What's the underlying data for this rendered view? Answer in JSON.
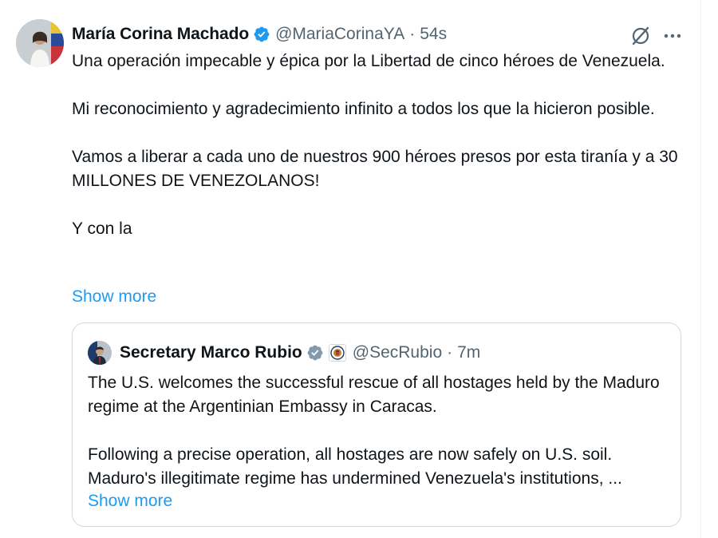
{
  "tweet": {
    "author_name": "María Corina Machado",
    "handle": "@MariaCorinaYA",
    "separator": "·",
    "time": "54s",
    "paragraphs": [
      "Una operación impecable y épica por la Libertad de cinco héroes de Venezuela.",
      "Mi reconocimiento y agradecimiento infinito a todos los que la hicieron posible.",
      "Vamos a liberar a cada uno de nuestros 900 héroes presos por esta tiranía y a 30 MILLONES DE VENEZOLANOS!",
      "Y con la"
    ],
    "show_more": "Show more"
  },
  "quoted_tweet": {
    "author_name": "Secretary Marco Rubio",
    "handle": "@SecRubio",
    "separator": "·",
    "time": "7m",
    "paragraphs": [
      "The U.S. welcomes the successful rescue of all hostages held by the Maduro regime at the Argentinian Embassy in Caracas.",
      "Following a precise operation, all hostages are now safely on U.S. soil. Maduro's illegitimate regime has undermined Venezuela's institutions, ..."
    ],
    "show_more": "Show more"
  },
  "icons": {
    "verified": "verified-badge-icon",
    "grok": "grok-icon",
    "more": "more-options-icon",
    "affiliation": "state-department-seal-icon"
  },
  "colors": {
    "link": "#1d9bf0",
    "verified": "#1d9bf0",
    "secondary_text": "#536471",
    "border": "#cfd9de"
  }
}
